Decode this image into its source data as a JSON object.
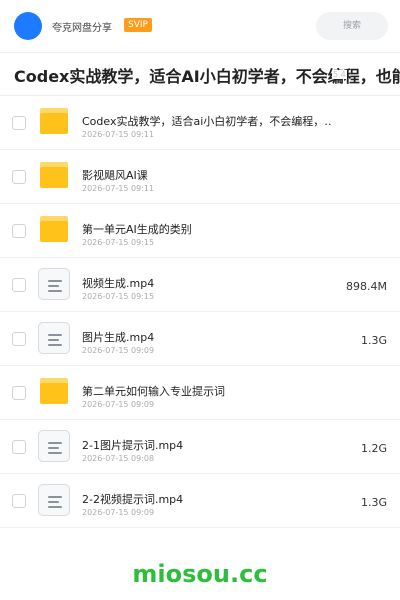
{
  "header": {
    "avatar_icon": "avatar-circle",
    "app_name": "夸克网盘分享",
    "badge": "SVIP",
    "search_placeholder": "搜索"
  },
  "title": {
    "text": "Codex实战教学，适合AI小白初学者，不会编程，也能让A",
    "faint_overlay": "5 4"
  },
  "files": [
    {
      "type": "folder",
      "name": "Codex实战教学，适合ai小白初学者，不会编程，…",
      "date": "2026-07-15 09:11",
      "size": ""
    },
    {
      "type": "folder",
      "name": "影视飓风AI课",
      "date": "2026-07-15 09:11",
      "size": ""
    },
    {
      "type": "folder",
      "name": "第一单元AI生成的类别",
      "date": "2026-07-15 09:15",
      "size": ""
    },
    {
      "type": "file",
      "name": "视频生成.mp4",
      "date": "2026-07-15 09:15",
      "size": "898.4M"
    },
    {
      "type": "file",
      "name": "图片生成.mp4",
      "date": "2026-07-15 09:09",
      "size": "1.3G"
    },
    {
      "type": "folder",
      "name": "第二单元如何输入专业提示词",
      "date": "2026-07-15 09:09",
      "size": ""
    },
    {
      "type": "file",
      "name": "2-1图片提示词.mp4",
      "date": "2026-07-15 09:08",
      "size": "1.2G"
    },
    {
      "type": "file",
      "name": "2-2视频提示词.mp4",
      "date": "2026-07-15 09:09",
      "size": "1.3G"
    }
  ],
  "watermark": "miosou.cc",
  "colors": {
    "accent": "#1e7bff",
    "badge": "#ff9c1a",
    "folder": "#ffc21a",
    "watermark": "#2bbf3c"
  }
}
